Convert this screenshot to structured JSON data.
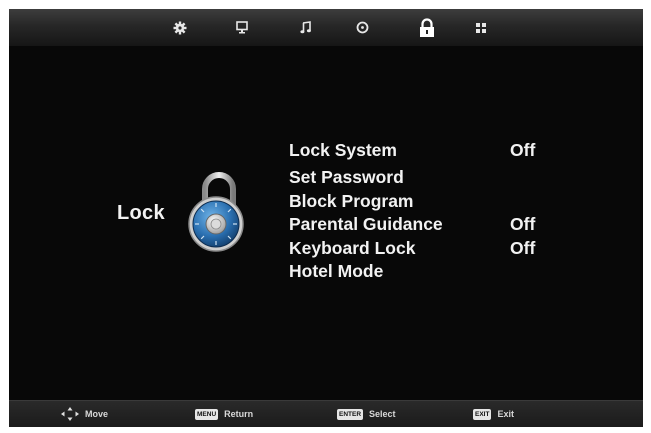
{
  "top_tabs": [
    {
      "icon": "gear-icon",
      "active": false
    },
    {
      "icon": "monitor-icon",
      "active": false
    },
    {
      "icon": "music-note-icon",
      "active": false
    },
    {
      "icon": "clock-icon",
      "active": false
    },
    {
      "icon": "lock-icon",
      "active": true
    },
    {
      "icon": "grid-icon",
      "active": false
    }
  ],
  "section": {
    "title": "Lock",
    "icon": "combination-padlock-icon"
  },
  "menu": {
    "items": [
      {
        "label": "Lock System",
        "value": "Off"
      },
      {
        "label": "Set Password",
        "value": ""
      },
      {
        "label": "Block Program",
        "value": ""
      },
      {
        "label": "Parental Guidance",
        "value": "Off"
      },
      {
        "label": "Keyboard Lock",
        "value": "Off"
      },
      {
        "label": "Hotel Mode",
        "value": ""
      }
    ]
  },
  "hints": {
    "move": {
      "label": "Move"
    },
    "return": {
      "key": "MENU",
      "label": "Return"
    },
    "select": {
      "key": "ENTER",
      "label": "Select"
    },
    "exit": {
      "key": "EXIT",
      "label": "Exit"
    }
  }
}
